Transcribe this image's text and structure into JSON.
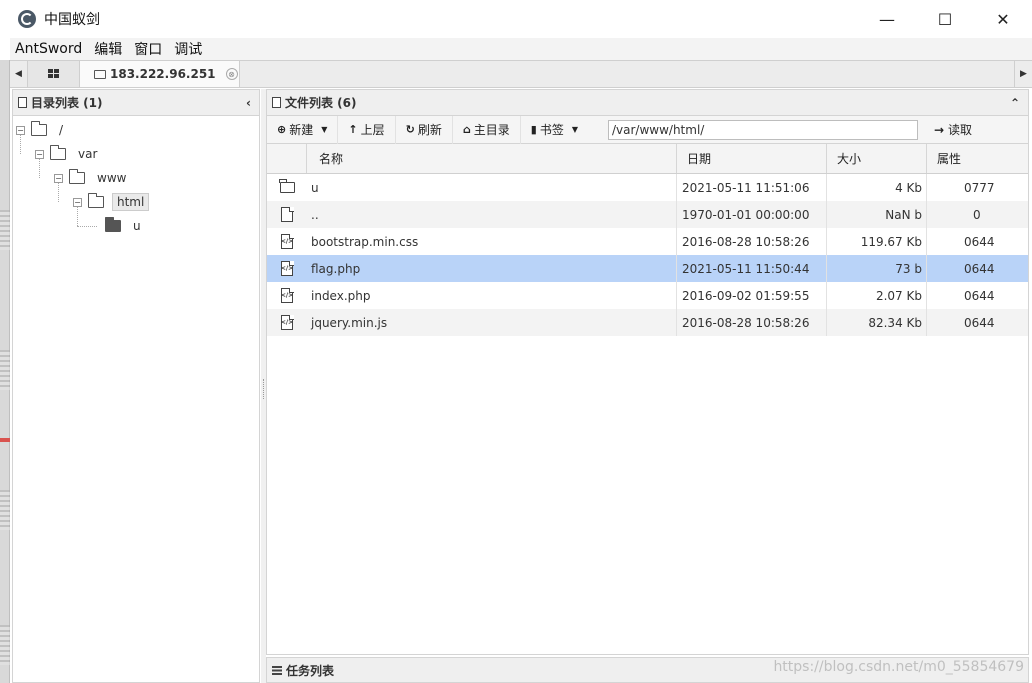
{
  "window": {
    "title": "中国蚁剑",
    "minimize": "—",
    "maximize": "☐",
    "close": "✕"
  },
  "menu": [
    "AntSword",
    "编辑",
    "窗口",
    "调试"
  ],
  "tabs": {
    "home_icon": "grid-icon",
    "active": "183.222.96.251",
    "close_glyph": "⊗"
  },
  "left_panel": {
    "title": "目录列表 (1)",
    "collapse_glyph": "‹",
    "tree": [
      {
        "label": "/",
        "toggle": "−"
      },
      {
        "label": "var",
        "toggle": "−"
      },
      {
        "label": "www",
        "toggle": "−"
      },
      {
        "label": "html",
        "toggle": "−",
        "selected": true
      },
      {
        "label": "u"
      }
    ]
  },
  "right_panel": {
    "title": "文件列表 (6)",
    "collapse_glyph": "⌃",
    "toolbar": {
      "new_label": "新建",
      "up_label": "上层",
      "refresh_label": "刷新",
      "home_label": "主目录",
      "bookmark_label": "书签",
      "path_value": "/var/www/html/",
      "read_label": "读取"
    },
    "columns": {
      "name": "名称",
      "date": "日期",
      "size": "大小",
      "attr": "属性"
    },
    "files": [
      {
        "icon": "folder-icon",
        "name": "u",
        "date": "2021-05-11 11:51:06",
        "size": "4 Kb",
        "attr": "0777"
      },
      {
        "icon": "file-icon",
        "name": "..",
        "date": "1970-01-01 00:00:00",
        "size": "NaN b",
        "attr": "0"
      },
      {
        "icon": "code-file-icon",
        "name": "bootstrap.min.css",
        "date": "2016-08-28 10:58:26",
        "size": "119.67 Kb",
        "attr": "0644"
      },
      {
        "icon": "code-file-icon",
        "name": "flag.php",
        "date": "2021-05-11 11:50:44",
        "size": "73 b",
        "attr": "0644",
        "selected": true
      },
      {
        "icon": "code-file-icon",
        "name": "index.php",
        "date": "2016-09-02 01:59:55",
        "size": "2.07 Kb",
        "attr": "0644"
      },
      {
        "icon": "code-file-icon",
        "name": "jquery.min.js",
        "date": "2016-08-28 10:58:26",
        "size": "82.34 Kb",
        "attr": "0644"
      }
    ]
  },
  "task_panel": {
    "title": "任务列表"
  },
  "watermark": "https://blog.csdn.net/m0_55854679"
}
